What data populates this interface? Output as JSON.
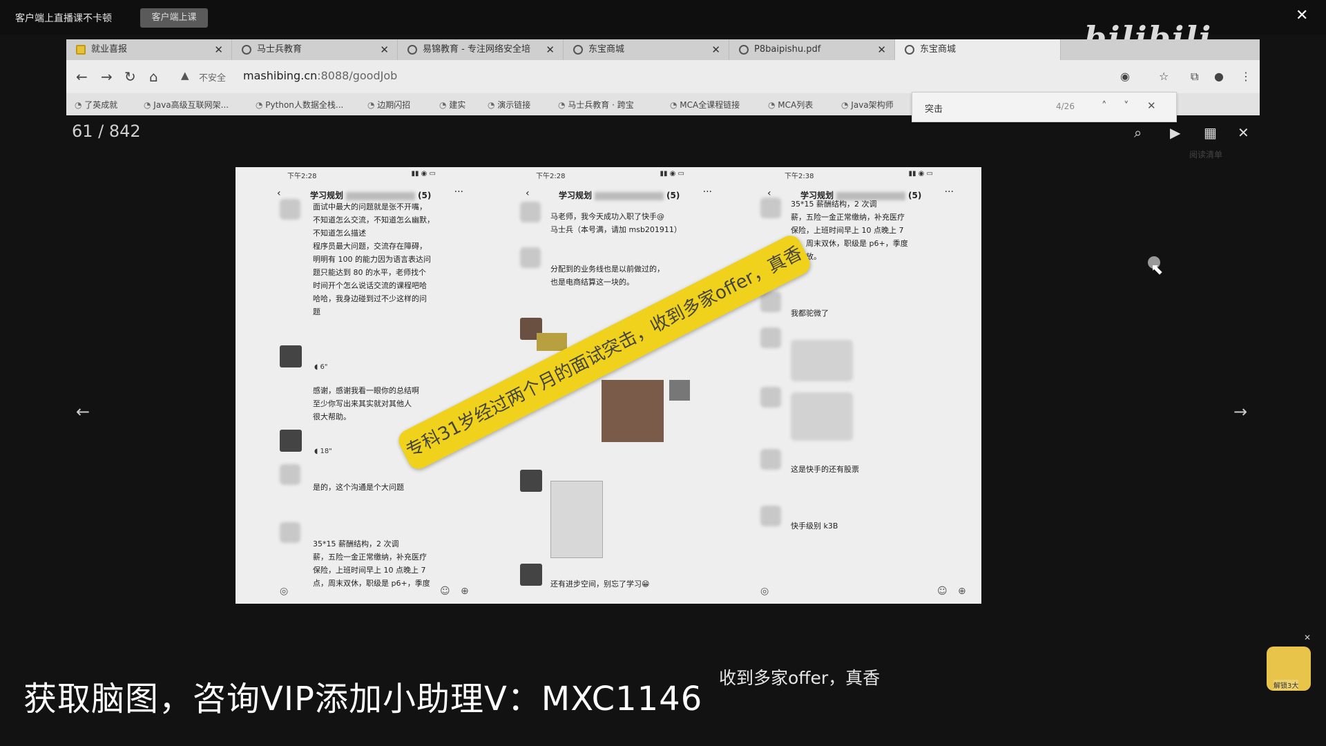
{
  "top_strip": {
    "title": "客户端上直播课不卡顿",
    "live_button": "客户端上课",
    "logo": "bilibili",
    "close": "✕"
  },
  "browser": {
    "tabs": [
      {
        "label": "就业喜报",
        "icon": "folder-icon"
      },
      {
        "label": "马士兵教育",
        "icon": "globe-icon"
      },
      {
        "label": "易锦教育 - 专注网络安全培",
        "icon": "refresh-icon"
      },
      {
        "label": "东宝商城",
        "icon": "globe-icon"
      },
      {
        "label": "P8baipishu.pdf",
        "icon": "globe-icon"
      },
      {
        "label": "东宝商城",
        "icon": "globe-icon"
      }
    ],
    "address": {
      "security": "不安全",
      "url_host": "mashibing.cn",
      "url_rest": ":8088/goodJob"
    },
    "bookmarks": [
      "了英成就",
      "Java高级互联网架...",
      "Python人数据全栈...",
      "边期闪招",
      "建实",
      "演示链接",
      "马士兵教育 · 跨宝",
      "MCA全课程链接",
      "MCA列表",
      "Java架构师"
    ],
    "find": {
      "query": "突击",
      "count": "4/26"
    },
    "reading_mode": "阅读清单"
  },
  "viewer": {
    "page_indicator": "61 / 842"
  },
  "slide": {
    "phones": [
      {
        "time": "下午2:28",
        "chat_name": "学习规划",
        "member_count": "(5)",
        "messages": [
          "面试中最大的问题就是张不开嘴，",
          "不知道怎么交流，不知道怎么幽默，",
          "不知道怎么描述",
          "程序员最大问题，交流存在障碍，",
          "明明有 100 的能力因为语言表达问",
          "题只能达到 80 的水平，老师找个",
          "时间开个怎么说话交流的课程吧哈",
          "哈哈，我身边碰到过不少这样的问",
          "题"
        ],
        "thanks_lines": [
          "感谢，感谢我看一眼你的总结啊",
          "至少你写出来其实就对其他人",
          "很大帮助。"
        ],
        "voice1": "6\"",
        "voice2": "18\"",
        "reply": "是的，这个沟通是个大问题",
        "salary_lines": [
          "35*15 薪酬结构，2 次调",
          "薪，五险一金正常缴纳，补充医疗",
          "保险，上班时间早上 10 点晚上 7",
          "点，周末双休，职级是 p6+，季度"
        ]
      },
      {
        "time": "下午2:28",
        "chat_name": "学习规划",
        "member_count": "(5)",
        "messages": [
          "马老师，我今天成功入职了快手@",
          "马士兵（本号满，请加 msb201911）"
        ],
        "messages2": [
          "分配到的业务线也是以前做过的，",
          "也是电商结算这一块的。"
        ],
        "bottom_msg": "还有进步空间，别忘了学习😁"
      },
      {
        "time": "下午2:38",
        "chat_name": "学习规划",
        "member_count": "(5)",
        "messages": [
          "35*15 薪酬结构，2 次调",
          "薪，五险一金正常缴纳，补充医疗",
          "保险，上班时间早上 10 点晚上 7",
          "点，周末双休，职级是 p6+，季度",
          "奖发放。"
        ],
        "m2": "我都驼微了",
        "m3": "这是快手的还有股票",
        "m4": "快手级别 k3B"
      }
    ],
    "banner": "专科31岁经过两个月的面试突击，收到多家offer，真香"
  },
  "subtitle": "获取脑图，咨询VIP添加小助理V：MXC1146",
  "caption": "收到多家offer，真香",
  "sticker_label": "解锁3大"
}
